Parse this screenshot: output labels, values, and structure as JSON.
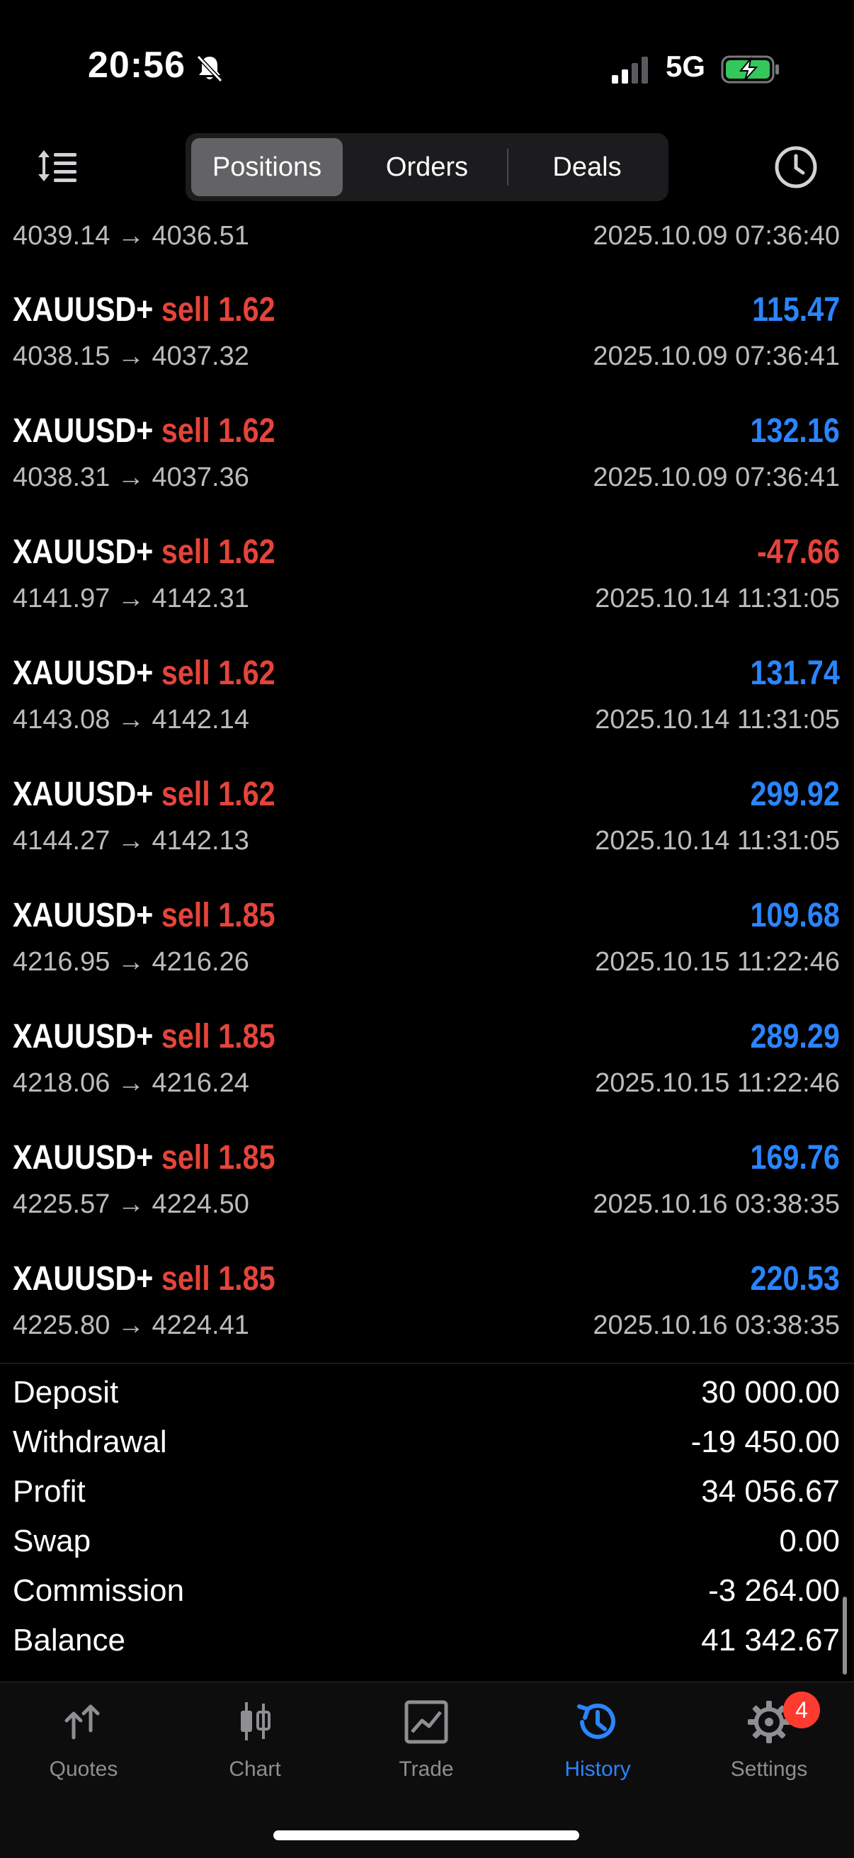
{
  "status_bar": {
    "time": "20:56",
    "network": "5G",
    "icons": [
      "bell-slash-icon",
      "signal-icon",
      "battery-charging-icon"
    ]
  },
  "toolbar": {
    "tabs": [
      {
        "label": "Positions",
        "active": true
      },
      {
        "label": "Orders",
        "active": false
      },
      {
        "label": "Deals",
        "active": false
      }
    ],
    "left_icon": "sort-icon",
    "right_icon": "clock-icon"
  },
  "partial_row": {
    "prices": "4039.14 → 4036.51",
    "time": "2025.10.09 07:36:40"
  },
  "deals": [
    {
      "symbol": "XAUUSD+",
      "side": "sell",
      "volume": "1.62",
      "profit": "115.47",
      "prices": "4038.15 → 4037.32",
      "time": "2025.10.09 07:36:41"
    },
    {
      "symbol": "XAUUSD+",
      "side": "sell",
      "volume": "1.62",
      "profit": "132.16",
      "prices": "4038.31 → 4037.36",
      "time": "2025.10.09 07:36:41"
    },
    {
      "symbol": "XAUUSD+",
      "side": "sell",
      "volume": "1.62",
      "profit": "-47.66",
      "prices": "4141.97 → 4142.31",
      "time": "2025.10.14 11:31:05"
    },
    {
      "symbol": "XAUUSD+",
      "side": "sell",
      "volume": "1.62",
      "profit": "131.74",
      "prices": "4143.08 → 4142.14",
      "time": "2025.10.14 11:31:05"
    },
    {
      "symbol": "XAUUSD+",
      "side": "sell",
      "volume": "1.62",
      "profit": "299.92",
      "prices": "4144.27 → 4142.13",
      "time": "2025.10.14 11:31:05"
    },
    {
      "symbol": "XAUUSD+",
      "side": "sell",
      "volume": "1.85",
      "profit": "109.68",
      "prices": "4216.95 → 4216.26",
      "time": "2025.10.15 11:22:46"
    },
    {
      "symbol": "XAUUSD+",
      "side": "sell",
      "volume": "1.85",
      "profit": "289.29",
      "prices": "4218.06 → 4216.24",
      "time": "2025.10.15 11:22:46"
    },
    {
      "symbol": "XAUUSD+",
      "side": "sell",
      "volume": "1.85",
      "profit": "169.76",
      "prices": "4225.57 → 4224.50",
      "time": "2025.10.16 03:38:35"
    },
    {
      "symbol": "XAUUSD+",
      "side": "sell",
      "volume": "1.85",
      "profit": "220.53",
      "prices": "4225.80 → 4224.41",
      "time": "2025.10.16 03:38:35"
    }
  ],
  "summary": [
    {
      "label": "Deposit",
      "value": "30 000.00"
    },
    {
      "label": "Withdrawal",
      "value": "-19 450.00"
    },
    {
      "label": "Profit",
      "value": "34 056.67"
    },
    {
      "label": "Swap",
      "value": "0.00"
    },
    {
      "label": "Commission",
      "value": "-3 264.00"
    },
    {
      "label": "Balance",
      "value": "41 342.67"
    }
  ],
  "tab_bar": {
    "items": [
      {
        "label": "Quotes",
        "icon": "quotes-icon",
        "active": false
      },
      {
        "label": "Chart",
        "icon": "candlestick-icon",
        "active": false
      },
      {
        "label": "Trade",
        "icon": "trade-icon",
        "active": false
      },
      {
        "label": "History",
        "icon": "history-icon",
        "active": true
      },
      {
        "label": "Settings",
        "icon": "gear-icon",
        "active": false
      }
    ],
    "settings_badge": "4"
  },
  "colors": {
    "profit_positive": "#2a85ff",
    "profit_negative": "#e5443b",
    "sell": "#e5443b",
    "active_tab": "#2a85ff"
  }
}
